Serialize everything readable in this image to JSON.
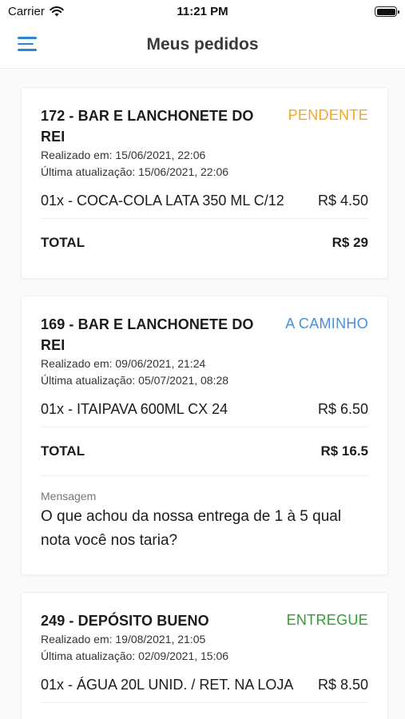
{
  "status_bar": {
    "carrier": "Carrier",
    "time": "11:21 PM",
    "wifi_icon": "wifi-icon",
    "battery_icon": "battery-icon"
  },
  "nav": {
    "menu_icon": "hamburger-menu-icon",
    "title": "Meus pedidos"
  },
  "colors": {
    "accent": "#2b86d9",
    "pendente": "#f5a623",
    "a_caminho": "#4a90d9",
    "entregue": "#2ea12e"
  },
  "orders": [
    {
      "title": "172 - BAR E LANCHONETE DO REI",
      "status": "PENDENTE",
      "created": "Realizado em: 15/06/2021, 22:06",
      "updated": "Última atualização: 15/06/2021, 22:06",
      "items": [
        {
          "desc": "01x - COCA-COLA  LATA 350 ML C/12",
          "price": "R$ 4.50"
        }
      ],
      "total_label": "TOTAL",
      "total_value": "R$ 29"
    },
    {
      "title": "169 - BAR E LANCHONETE DO REI",
      "status": "A CAMINHO",
      "created": "Realizado em: 09/06/2021, 21:24",
      "updated": "Última atualização: 05/07/2021, 08:28",
      "items": [
        {
          "desc": "01x - ITAIPAVA 600ML  CX  24",
          "price": "R$ 6.50"
        }
      ],
      "total_label": "TOTAL",
      "total_value": "R$ 16.5",
      "message_label": "Mensagem",
      "message": "O que achou da nossa entrega de 1 à 5 qual nota você nos taria?"
    },
    {
      "title": "249 - DEPÓSITO BUENO",
      "status": "ENTREGUE",
      "created": "Realizado em: 19/08/2021, 21:05",
      "updated": "Última atualização: 02/09/2021, 15:06",
      "items": [
        {
          "desc": "01x - ÁGUA  20L  UNID. / RET. NA LOJA",
          "price": "R$ 8.50"
        }
      ]
    }
  ]
}
